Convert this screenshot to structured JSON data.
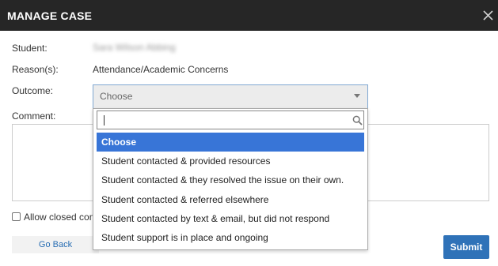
{
  "dialog": {
    "title": "MANAGE CASE",
    "close_icon": "close-icon"
  },
  "form": {
    "student_label": "Student:",
    "student_value": "Sara Wilson Abbing",
    "reasons_label": "Reason(s):",
    "reasons_value": "Attendance/Academic Concerns",
    "outcome_label": "Outcome:",
    "outcome_selected": "Choose",
    "comment_label": "Comment:",
    "comment_value": "",
    "allow_closed_label": "Allow closed con"
  },
  "dropdown": {
    "search_value": "",
    "search_icon": "search-icon",
    "options": [
      "Choose",
      "Student contacted & provided resources",
      "Student contacted & they resolved the issue on their own.",
      "Student contacted & referred elsewhere",
      "Student contacted by text & email, but did not respond",
      "Student support is in place and ongoing"
    ],
    "selected_index": 0
  },
  "buttons": {
    "go_back": "Go Back",
    "submit": "Submit"
  },
  "colors": {
    "titlebar": "#262626",
    "accent": "#3875d7",
    "submit": "#2f72b8"
  }
}
